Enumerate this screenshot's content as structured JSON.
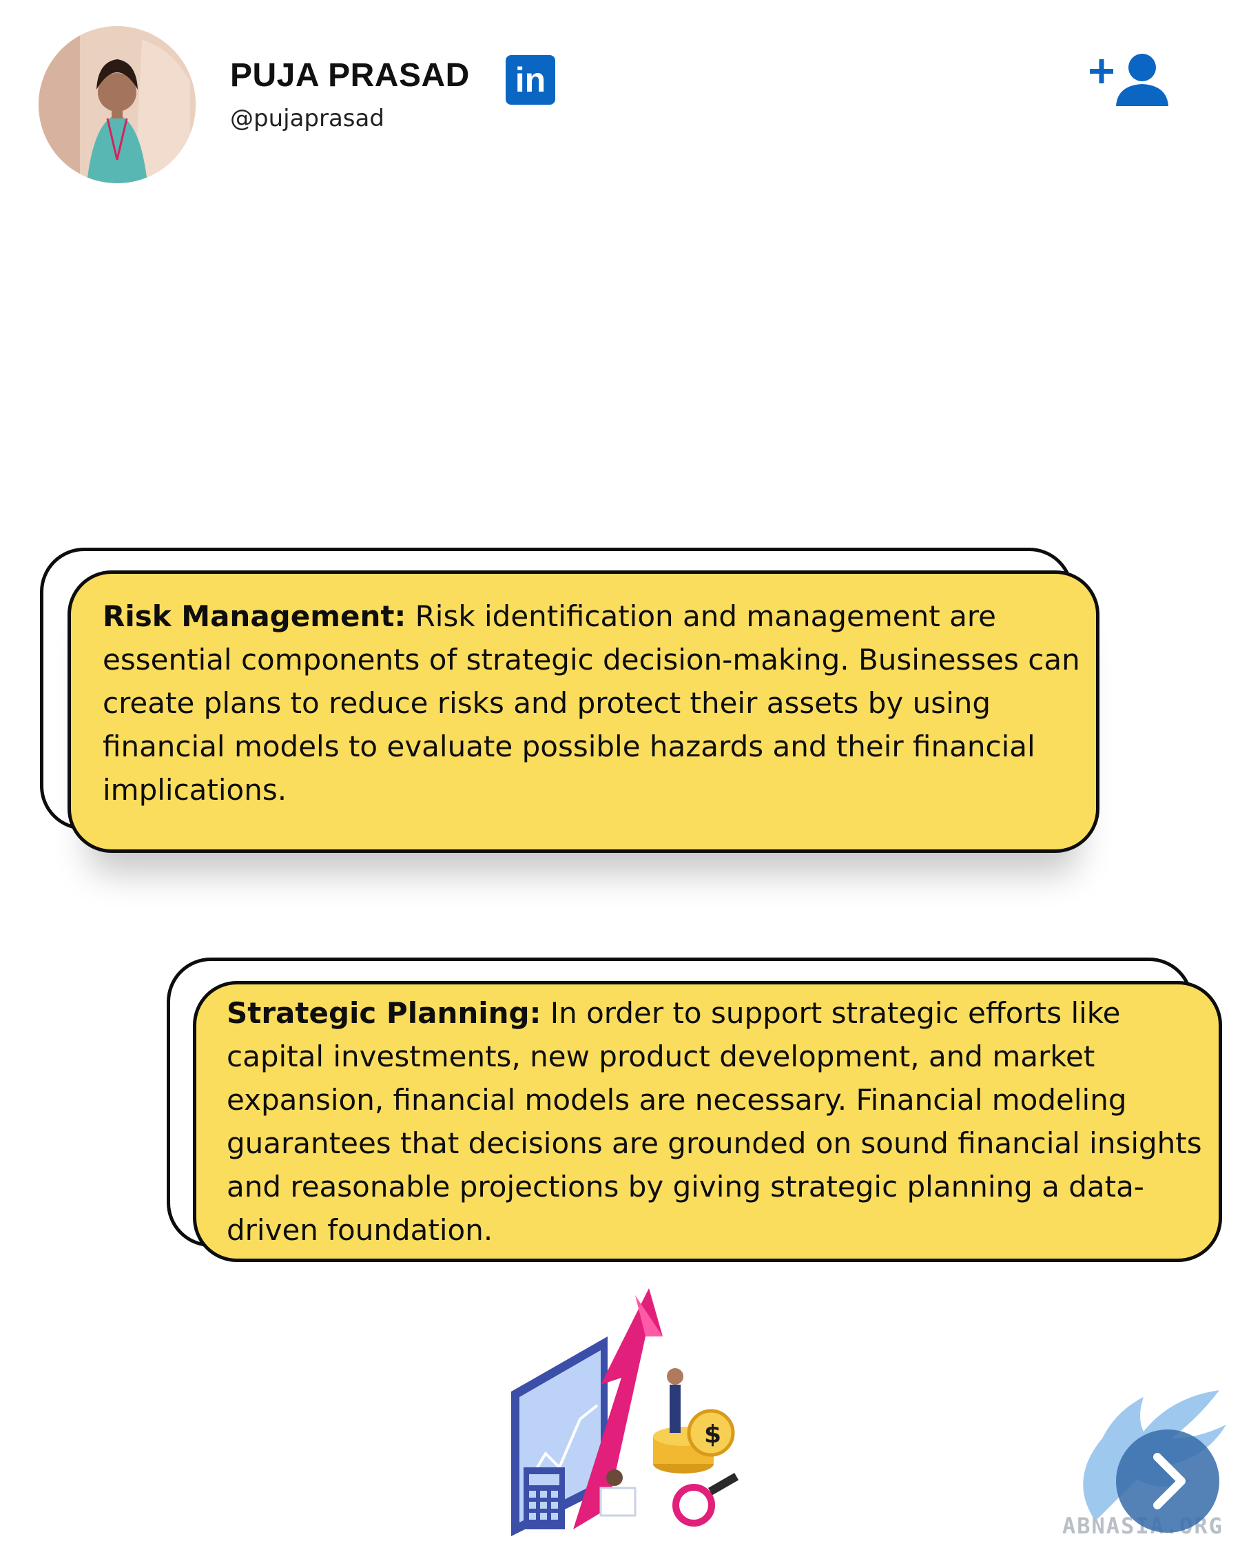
{
  "profile": {
    "name": "PUJA PRASAD",
    "handle": "@pujaprasad",
    "linkedin_label": "in"
  },
  "cards": [
    {
      "heading": "Risk Management:",
      "text": " Risk identification and management are essential components of strategic decision-making. Businesses can create plans to reduce risks and protect their assets by using financial models to evaluate possible hazards and their financial implications."
    },
    {
      "heading": "Strategic Planning:",
      "text": " In order to support strategic efforts like capital investments, new product development, and market expansion, financial models are necessary. Financial modeling guarantees that decisions are grounded on sound financial insights and reasonable projections by giving strategic planning a data-driven foundation."
    }
  ],
  "watermark": {
    "text": "ABNASIA.ORG"
  },
  "icons": {
    "linkedin": "linkedin-icon",
    "follow": "add-user-icon",
    "next": "chevron-right-icon"
  },
  "colors": {
    "card_fill": "#fbdd5e",
    "linkedin_blue": "#0a66c2",
    "follow_blue": "#0a66c2"
  }
}
